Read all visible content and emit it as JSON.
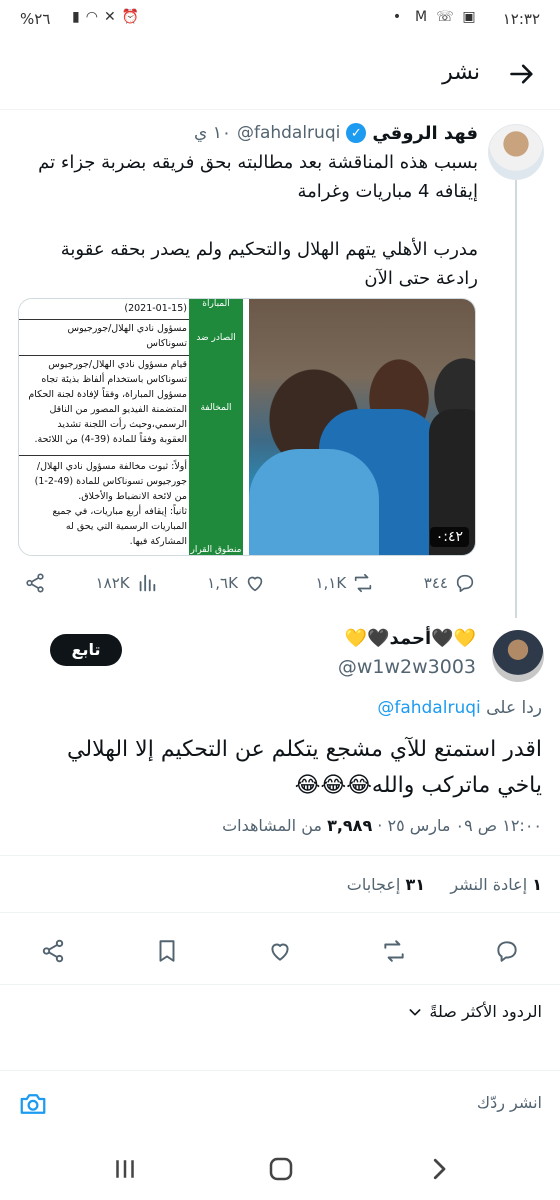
{
  "status_bar": {
    "time": "١٢:٣٢",
    "battery": "%٢٦",
    "notification_icons": [
      "mail-icon",
      "gmail-icon",
      "missed-call-icon",
      "image-icon",
      "dot-icon"
    ],
    "system_icons": [
      "battery-icon",
      "signal-icon",
      "wifi-icon",
      "mute-icon",
      "alarm-icon"
    ]
  },
  "header": {
    "title": "نشر",
    "back_icon": "arrow-right-icon"
  },
  "original_tweet": {
    "display_name": "فهد الروقي",
    "handle": "@fahdalruqi",
    "time": "١٠ ي",
    "text": "بسبب هذه المناقشة بعد مطالبته بحق فريقه بضربة جزاء تم إيقافه 4 مباريات وغرامة\n\nمدرب الأهلي يتهم الهلال والتحكيم ولم يصدر بحقه عقوبة رادعة حتى الآن",
    "media": {
      "duration": "٠:٤٢",
      "doc_labels": [
        "المباراة",
        "الصادر ضد",
        "المخالفة",
        "منطوق القرار"
      ],
      "doc_rows": [
        "(2021-01-15)",
        "مسؤول نادي الهلال/جورجيوس\nتسوناكاس",
        "قيام مسؤول نادي الهلال/جورجيوس\nتسوناكاس باستخدام ألفاظ بذيئة تجاه\nمسؤول المباراة، وفقاً لإفادة لجنة الحكام\nالمتضمنة الفيديو المصور من الناقل\nالرسمي،وحيث رأت اللجنة تشديد\nالعقوبة وفقاً للمادة (39-4) من اللائحة.",
        "أولاً: ثبوت مخالفة مسؤول نادي الهلال/\nجورجيوس تسوناكاس للمادة (49-2-1)\nمن لائحة الانضباط والأخلاق.\nثانياً: إيقافه أربع مباريات، في جميع\nالمباريات الرسمية التي يحق له\nالمشاركة فيها."
      ]
    },
    "actions": {
      "replies": "٣٤٤",
      "reposts": "١,١K",
      "likes": "١,٦K",
      "views": "١٨٢K"
    }
  },
  "reply": {
    "display_name": "💛🖤أحمد🖤💛",
    "handle": "@w1w2w3003",
    "follow_label": "تابع",
    "reply_to_prefix": "ردا على",
    "reply_to_handle": "@fahdalruqi",
    "text": "اقدر استمتع للآي مشجع يتكلم عن التحكيم إلا الهلالي\nياخي ماتركب والله😂😂😂",
    "meta_time": "١٢:٠٠ ص ٠٩ مارس ٢٥",
    "meta_views": "٣,٩٨٩",
    "meta_views_label": "من المشاهدات",
    "reposts_count": "١",
    "reposts_label": "إعادة النشر",
    "likes_count": "٣١",
    "likes_label": "إعجابات"
  },
  "replies_sort": {
    "label": "الردود الأكثر صلةً"
  },
  "composer": {
    "placeholder": "انشر ردّك"
  },
  "navbar": {
    "buttons": [
      "recent-apps-icon",
      "home-icon",
      "back-icon"
    ]
  }
}
